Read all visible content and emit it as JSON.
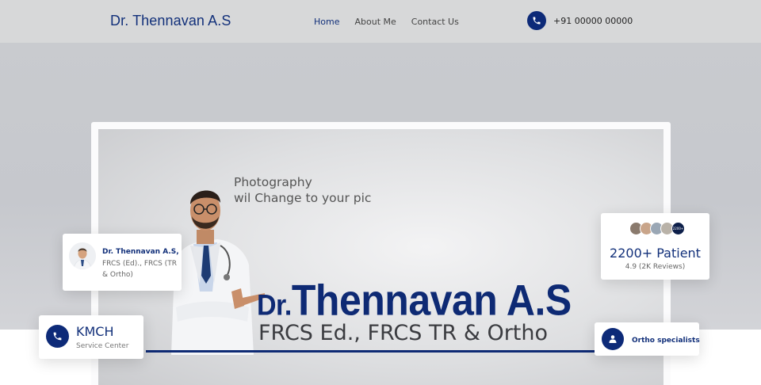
{
  "header": {
    "brand": "Dr. Thennavan A.S",
    "nav": [
      {
        "label": "Home",
        "active": true
      },
      {
        "label": "About Me",
        "active": false
      },
      {
        "label": "Contact Us",
        "active": false
      }
    ],
    "phone": "+91 00000 00000"
  },
  "banner": {
    "photo_note_line1": "Photography",
    "photo_note_line2": "wil Change to your pic",
    "name_prefix": "Dr.",
    "name": "Thennavan A.S",
    "qualifications": "FRCS Ed., FRCS TR & Ortho"
  },
  "cards": {
    "doctor": {
      "name": "Dr. Thennavan A.S,",
      "desc": "FRCS (Ed)., FRCS (TR & Ortho)"
    },
    "kmch": {
      "title": "KMCH",
      "subtitle": "Service Center"
    },
    "patients": {
      "count": "2200+ Patient",
      "reviews": "4.9 (2K Reviews)",
      "badge": "2200+"
    },
    "ortho": {
      "label": "Ortho specialists"
    }
  },
  "colors": {
    "brand_navy": "#12307a",
    "icon_navy": "#0d2a78",
    "header_bg": "#d7d8d9"
  },
  "icons": {
    "phone": "phone-icon",
    "user": "user-icon"
  }
}
